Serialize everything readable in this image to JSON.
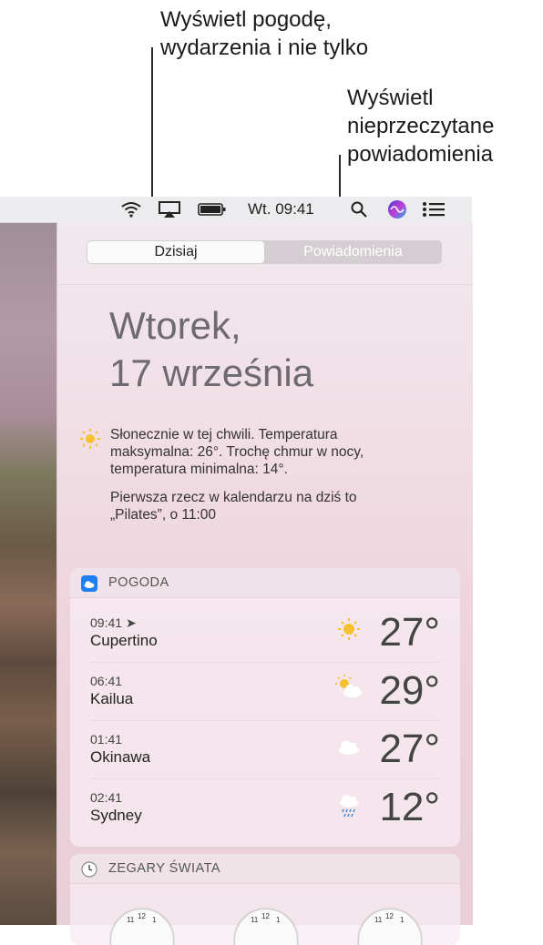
{
  "callouts": {
    "today": [
      "Wyświetl pogodę,",
      "wydarzenia i nie tylko"
    ],
    "notifications": [
      "Wyświetl",
      "nieprzeczytane",
      "powiadomienia"
    ]
  },
  "menubar": {
    "time": "Wt. 09:41",
    "icons": [
      "wifi-icon",
      "airplay-icon",
      "battery-icon",
      "search-icon",
      "siri-icon",
      "notification-center-icon"
    ]
  },
  "tabs": {
    "today": "Dzisiaj",
    "notifications": "Powiadomienia",
    "selected": "Dzisiaj"
  },
  "date": {
    "line1": "Wtorek,",
    "line2": "17 września"
  },
  "summary": {
    "weather": "Słonecznie w tej chwili. Temperatura maksymalna: 26°. Trochę chmur w nocy, temperatura minimalna: 14°.",
    "calendar": "Pierwsza rzecz w kalendarzu na dziś to „Pilates”, o 11:00"
  },
  "weather": {
    "title": "POGODA",
    "rows": [
      {
        "time": "09:41",
        "city": "Cupertino",
        "temp": "27°",
        "icon": "sun-icon"
      },
      {
        "time": "06:41",
        "city": "Kailua",
        "temp": "29°",
        "icon": "partly-cloudy-icon"
      },
      {
        "time": "01:41",
        "city": "Okinawa",
        "temp": "27°",
        "icon": "cloud-icon"
      },
      {
        "time": "02:41",
        "city": "Sydney",
        "temp": "12°",
        "icon": "rain-icon"
      }
    ]
  },
  "world_clock": {
    "title": "ZEGARY ŚWIATA",
    "dial": {
      "twelve": "12",
      "eleven": "11",
      "one": "1"
    }
  },
  "colors": {
    "accent_blue": "#1f7ef0",
    "sun_yellow": "#f6c12e"
  }
}
